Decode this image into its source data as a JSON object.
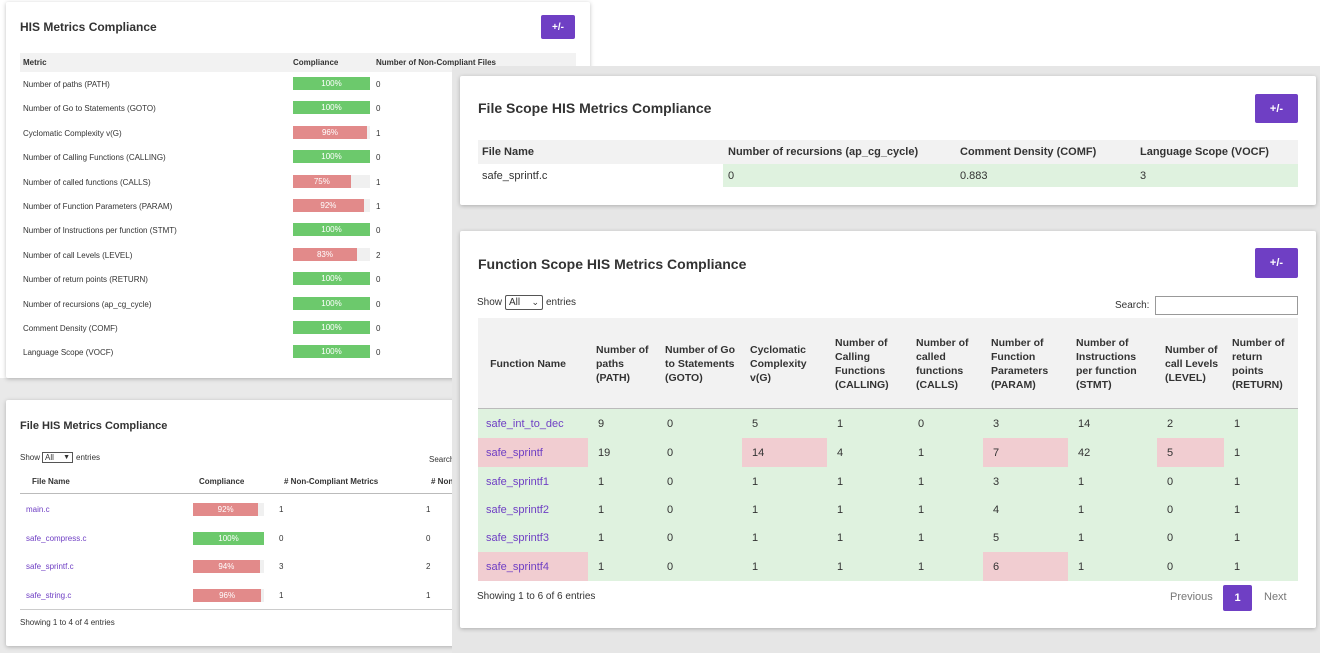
{
  "his_panel": {
    "title": "HIS Metrics Compliance",
    "toggle": "+/-",
    "headers": [
      "Metric",
      "Compliance",
      "Number of Non-Compliant Files"
    ],
    "rows": [
      {
        "metric": "Number of paths (PATH)",
        "pct": 100,
        "label": "100%",
        "count": "0"
      },
      {
        "metric": "Number of Go to Statements (GOTO)",
        "pct": 100,
        "label": "100%",
        "count": "0"
      },
      {
        "metric": "Cyclomatic Complexity v(G)",
        "pct": 96,
        "label": "96%",
        "count": "1"
      },
      {
        "metric": "Number of Calling Functions (CALLING)",
        "pct": 100,
        "label": "100%",
        "count": "0"
      },
      {
        "metric": "Number of called functions (CALLS)",
        "pct": 75,
        "label": "75%",
        "count": "1"
      },
      {
        "metric": "Number of Function Parameters (PARAM)",
        "pct": 92,
        "label": "92%",
        "count": "1"
      },
      {
        "metric": "Number of Instructions per function (STMT)",
        "pct": 100,
        "label": "100%",
        "count": "0"
      },
      {
        "metric": "Number of call Levels (LEVEL)",
        "pct": 83,
        "label": "83%",
        "count": "2"
      },
      {
        "metric": "Number of return points (RETURN)",
        "pct": 100,
        "label": "100%",
        "count": "0"
      },
      {
        "metric": "Number of recursions (ap_cg_cycle)",
        "pct": 100,
        "label": "100%",
        "count": "0"
      },
      {
        "metric": "Comment Density (COMF)",
        "pct": 100,
        "label": "100%",
        "count": "0"
      },
      {
        "metric": "Language Scope (VOCF)",
        "pct": 100,
        "label": "100%",
        "count": "0"
      }
    ]
  },
  "file_his_panel": {
    "title": "File HIS Metrics Compliance",
    "show": "Show",
    "select_value": "All",
    "entries": "entries",
    "search": "Search",
    "headers": [
      "File Name",
      "Compliance",
      "# Non-Compliant Metrics",
      "# Non"
    ],
    "rows": [
      {
        "file": "main.c",
        "pct": 92,
        "label": "92%",
        "metrics": "1",
        "non": "1"
      },
      {
        "file": "safe_compress.c",
        "pct": 100,
        "label": "100%",
        "metrics": "0",
        "non": "0"
      },
      {
        "file": "safe_sprintf.c",
        "pct": 94,
        "label": "94%",
        "metrics": "3",
        "non": "2"
      },
      {
        "file": "safe_string.c",
        "pct": 96,
        "label": "96%",
        "metrics": "1",
        "non": "1"
      }
    ],
    "footer": "Showing 1 to 4 of 4 entries"
  },
  "file_scope_panel": {
    "title": "File Scope HIS Metrics Compliance",
    "toggle": "+/-",
    "headers": [
      "File Name",
      "Number of recursions (ap_cg_cycle)",
      "Comment Density (COMF)",
      "Language Scope (VOCF)"
    ],
    "row": [
      "safe_sprintf.c",
      "0",
      "0.883",
      "3"
    ]
  },
  "function_scope_panel": {
    "title": "Function Scope HIS Metrics Compliance",
    "toggle": "+/-",
    "show": "Show",
    "select_value": "All",
    "entries": "entries",
    "search_label": "Search:",
    "headers": [
      "Function Name",
      "Number of paths (PATH)",
      "Number of Go to Statements (GOTO)",
      "Cyclomatic Complexity v(G)",
      "Number of Calling Functions (CALLING)",
      "Number of called functions (CALLS)",
      "Number of Function Parameters (PARAM)",
      "Number of Instructions per function (STMT)",
      "Number of call Levels (LEVEL)",
      "Number of return points (RETURN)"
    ],
    "rows": [
      {
        "cells": [
          "safe_int_to_dec",
          "9",
          "0",
          "5",
          "1",
          "0",
          "3",
          "14",
          "2",
          "1"
        ],
        "bad": []
      },
      {
        "cells": [
          "safe_sprintf",
          "19",
          "0",
          "14",
          "4",
          "1",
          "7",
          "42",
          "5",
          "1"
        ],
        "bad": [
          0,
          3,
          6,
          8
        ]
      },
      {
        "cells": [
          "safe_sprintf1",
          "1",
          "0",
          "1",
          "1",
          "1",
          "3",
          "1",
          "0",
          "1"
        ],
        "bad": []
      },
      {
        "cells": [
          "safe_sprintf2",
          "1",
          "0",
          "1",
          "1",
          "1",
          "4",
          "1",
          "0",
          "1"
        ],
        "bad": []
      },
      {
        "cells": [
          "safe_sprintf3",
          "1",
          "0",
          "1",
          "1",
          "1",
          "5",
          "1",
          "0",
          "1"
        ],
        "bad": []
      },
      {
        "cells": [
          "safe_sprintf4",
          "1",
          "0",
          "1",
          "1",
          "1",
          "6",
          "1",
          "0",
          "1"
        ],
        "bad": [
          0,
          6
        ]
      }
    ],
    "footer": "Showing 1 to 6 of 6 entries",
    "pager": {
      "previous": "Previous",
      "page": "1",
      "next": "Next"
    }
  }
}
